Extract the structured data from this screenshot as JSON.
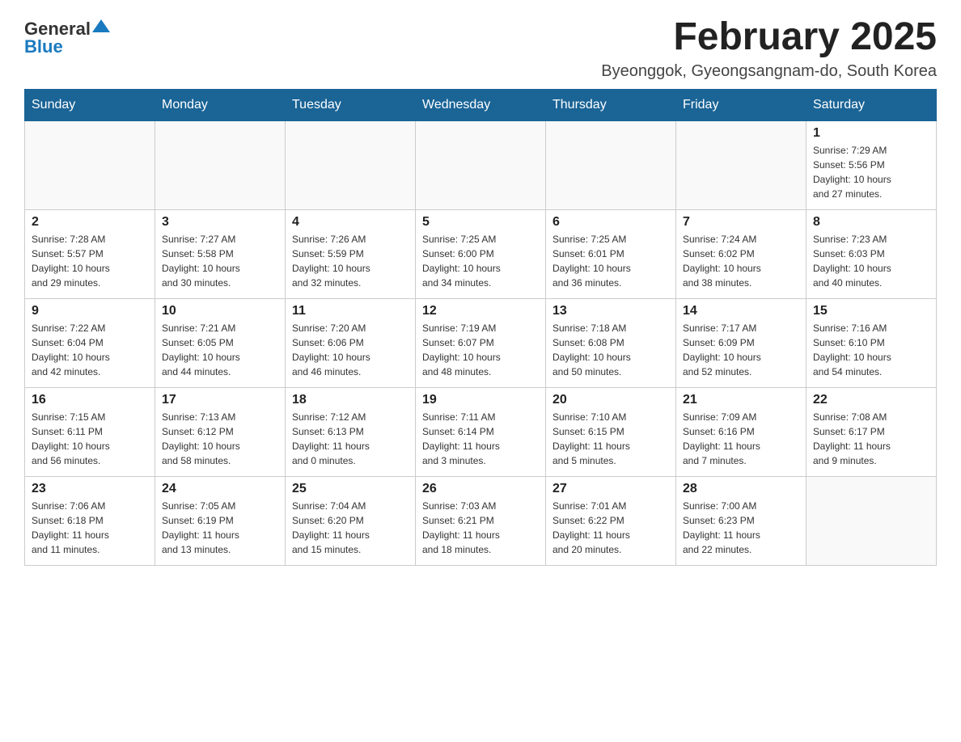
{
  "header": {
    "logo_general": "General",
    "logo_blue": "Blue",
    "month_title": "February 2025",
    "location": "Byeonggok, Gyeongsangnam-do, South Korea"
  },
  "weekdays": [
    "Sunday",
    "Monday",
    "Tuesday",
    "Wednesday",
    "Thursday",
    "Friday",
    "Saturday"
  ],
  "weeks": [
    [
      {
        "day": "",
        "info": ""
      },
      {
        "day": "",
        "info": ""
      },
      {
        "day": "",
        "info": ""
      },
      {
        "day": "",
        "info": ""
      },
      {
        "day": "",
        "info": ""
      },
      {
        "day": "",
        "info": ""
      },
      {
        "day": "1",
        "info": "Sunrise: 7:29 AM\nSunset: 5:56 PM\nDaylight: 10 hours\nand 27 minutes."
      }
    ],
    [
      {
        "day": "2",
        "info": "Sunrise: 7:28 AM\nSunset: 5:57 PM\nDaylight: 10 hours\nand 29 minutes."
      },
      {
        "day": "3",
        "info": "Sunrise: 7:27 AM\nSunset: 5:58 PM\nDaylight: 10 hours\nand 30 minutes."
      },
      {
        "day": "4",
        "info": "Sunrise: 7:26 AM\nSunset: 5:59 PM\nDaylight: 10 hours\nand 32 minutes."
      },
      {
        "day": "5",
        "info": "Sunrise: 7:25 AM\nSunset: 6:00 PM\nDaylight: 10 hours\nand 34 minutes."
      },
      {
        "day": "6",
        "info": "Sunrise: 7:25 AM\nSunset: 6:01 PM\nDaylight: 10 hours\nand 36 minutes."
      },
      {
        "day": "7",
        "info": "Sunrise: 7:24 AM\nSunset: 6:02 PM\nDaylight: 10 hours\nand 38 minutes."
      },
      {
        "day": "8",
        "info": "Sunrise: 7:23 AM\nSunset: 6:03 PM\nDaylight: 10 hours\nand 40 minutes."
      }
    ],
    [
      {
        "day": "9",
        "info": "Sunrise: 7:22 AM\nSunset: 6:04 PM\nDaylight: 10 hours\nand 42 minutes."
      },
      {
        "day": "10",
        "info": "Sunrise: 7:21 AM\nSunset: 6:05 PM\nDaylight: 10 hours\nand 44 minutes."
      },
      {
        "day": "11",
        "info": "Sunrise: 7:20 AM\nSunset: 6:06 PM\nDaylight: 10 hours\nand 46 minutes."
      },
      {
        "day": "12",
        "info": "Sunrise: 7:19 AM\nSunset: 6:07 PM\nDaylight: 10 hours\nand 48 minutes."
      },
      {
        "day": "13",
        "info": "Sunrise: 7:18 AM\nSunset: 6:08 PM\nDaylight: 10 hours\nand 50 minutes."
      },
      {
        "day": "14",
        "info": "Sunrise: 7:17 AM\nSunset: 6:09 PM\nDaylight: 10 hours\nand 52 minutes."
      },
      {
        "day": "15",
        "info": "Sunrise: 7:16 AM\nSunset: 6:10 PM\nDaylight: 10 hours\nand 54 minutes."
      }
    ],
    [
      {
        "day": "16",
        "info": "Sunrise: 7:15 AM\nSunset: 6:11 PM\nDaylight: 10 hours\nand 56 minutes."
      },
      {
        "day": "17",
        "info": "Sunrise: 7:13 AM\nSunset: 6:12 PM\nDaylight: 10 hours\nand 58 minutes."
      },
      {
        "day": "18",
        "info": "Sunrise: 7:12 AM\nSunset: 6:13 PM\nDaylight: 11 hours\nand 0 minutes."
      },
      {
        "day": "19",
        "info": "Sunrise: 7:11 AM\nSunset: 6:14 PM\nDaylight: 11 hours\nand 3 minutes."
      },
      {
        "day": "20",
        "info": "Sunrise: 7:10 AM\nSunset: 6:15 PM\nDaylight: 11 hours\nand 5 minutes."
      },
      {
        "day": "21",
        "info": "Sunrise: 7:09 AM\nSunset: 6:16 PM\nDaylight: 11 hours\nand 7 minutes."
      },
      {
        "day": "22",
        "info": "Sunrise: 7:08 AM\nSunset: 6:17 PM\nDaylight: 11 hours\nand 9 minutes."
      }
    ],
    [
      {
        "day": "23",
        "info": "Sunrise: 7:06 AM\nSunset: 6:18 PM\nDaylight: 11 hours\nand 11 minutes."
      },
      {
        "day": "24",
        "info": "Sunrise: 7:05 AM\nSunset: 6:19 PM\nDaylight: 11 hours\nand 13 minutes."
      },
      {
        "day": "25",
        "info": "Sunrise: 7:04 AM\nSunset: 6:20 PM\nDaylight: 11 hours\nand 15 minutes."
      },
      {
        "day": "26",
        "info": "Sunrise: 7:03 AM\nSunset: 6:21 PM\nDaylight: 11 hours\nand 18 minutes."
      },
      {
        "day": "27",
        "info": "Sunrise: 7:01 AM\nSunset: 6:22 PM\nDaylight: 11 hours\nand 20 minutes."
      },
      {
        "day": "28",
        "info": "Sunrise: 7:00 AM\nSunset: 6:23 PM\nDaylight: 11 hours\nand 22 minutes."
      },
      {
        "day": "",
        "info": ""
      }
    ]
  ]
}
